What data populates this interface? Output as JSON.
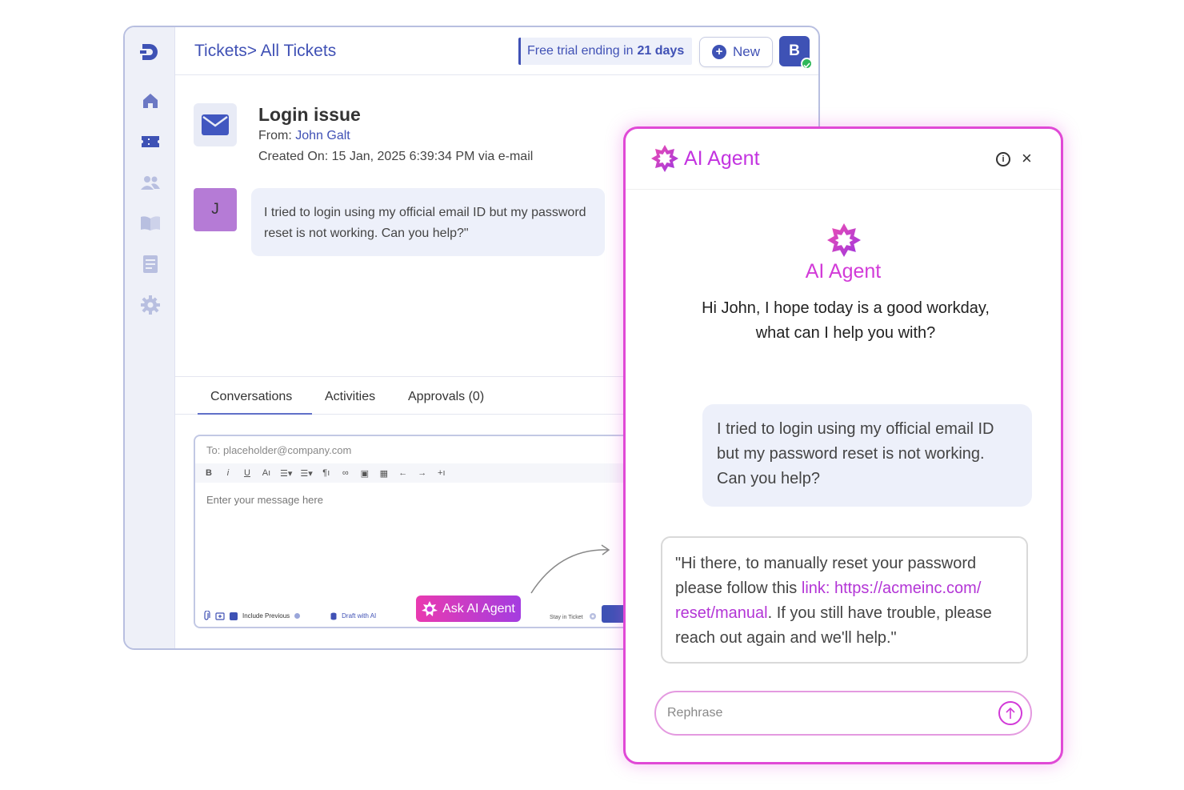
{
  "app": {
    "breadcrumb": "Tickets> All Tickets",
    "trial_prefix": "Free trial ending in",
    "trial_days": "21 days",
    "new_button": "New",
    "user_initial": "B"
  },
  "ticket": {
    "title": "Login issue",
    "from_label": "From:",
    "from_name": "John Galt",
    "created": "Created On: 15 Jan, 2025 6:39:34 PM via e-mail",
    "requester_initial": "J",
    "message": "I tried to login using my official email ID but my password reset is not working. Can you help?\""
  },
  "tabs": [
    "Conversations",
    "Activities",
    "Approvals (0)"
  ],
  "composer": {
    "to_placeholder": "To: placeholder@company.com",
    "toolbar": [
      "B",
      "i",
      "U",
      "Aı",
      "☰▾",
      "☰▾",
      "¶ı",
      "∞",
      "▣",
      "▦",
      "←",
      "→",
      "+ı"
    ],
    "message_placeholder": "Enter your message here",
    "include_previous": "Include Previous",
    "draft_with_ai": "Draft with AI",
    "ask_ai_button": "Ask AI Agent",
    "stay_in_ticket": "Stay in Ticket"
  },
  "agent": {
    "header_title": "AI Agent",
    "name": "AI Agent",
    "greeting": "Hi John, I hope today is a good workday, what can I help you with?",
    "user_message": "I tried to login using my official email ID but my password reset is not working. Can you help?",
    "reply_before_link": "\"Hi there, to manually reset your password please follow this ",
    "reply_link": "link: https://acmeinc.com/ reset/manual",
    "reply_after_link": ". If you still have trouble, please reach out again and we'll help.\"",
    "input_placeholder": "Rephrase"
  },
  "colors": {
    "brand_blue": "#3e52b5",
    "agent_magenta": "#d23bd8",
    "bubble_bg": "#edf0fa"
  }
}
